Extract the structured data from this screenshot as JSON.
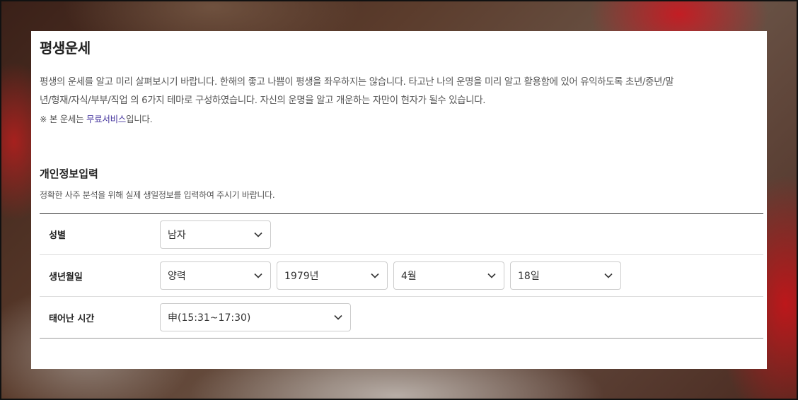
{
  "page": {
    "title": "평생운세",
    "intro": "평생의 운세를 알고 미리 살펴보시기 바랍니다. 한해의 좋고 나쁨이 평생을 좌우하지는 않습니다. 타고난 나의 운명을 미리 알고 활용함에 있어 유익하도록 초년/중년/말\n년/형재/자식/부부/직업 의 6가지 테마로 구성하였습니다. 자신의 운명을 알고 개운하는 자만이 현자가 될수 있습니다.",
    "note_prefix": "※ 본 운세는 ",
    "note_link": "무료서비스",
    "note_suffix": "입니다."
  },
  "section": {
    "title": "개인정보입력",
    "description": "정확한 사주 분석을 위해 실제 생일정보를 입력하여 주시기 바랍니다."
  },
  "form": {
    "gender": {
      "label": "성별",
      "value": "남자"
    },
    "birthdate": {
      "label": "생년월일",
      "calendar": "양력",
      "year": "1979년",
      "month": "4월",
      "day": "18일"
    },
    "birthtime": {
      "label": "태어난 시간",
      "value": "申(15:31~17:30)"
    }
  },
  "icons": {
    "dropdown": "chevron-down-icon"
  }
}
